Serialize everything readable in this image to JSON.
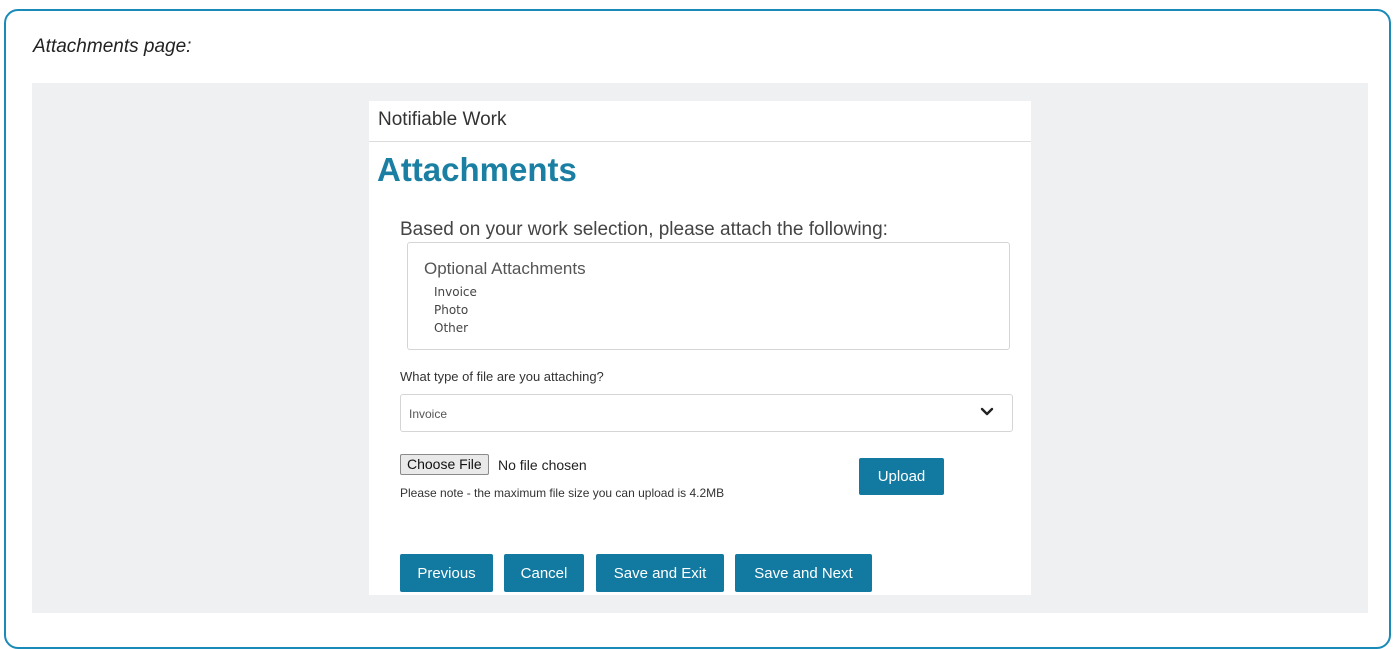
{
  "caption": "Attachments page:",
  "header": {
    "title": "Notifiable Work"
  },
  "page_title": "Attachments",
  "intro_text": "Based on your work selection, please attach the following:",
  "attachments": {
    "title": "Optional Attachments",
    "items": [
      "Invoice",
      "Photo",
      "Other"
    ]
  },
  "file_type": {
    "label": "What type of file are you attaching?",
    "selected": "Invoice"
  },
  "file_input": {
    "button_label": "Choose File",
    "status": "No file chosen"
  },
  "size_note": "Please note - the maximum file size you can upload is 4.2MB",
  "buttons": {
    "upload": "Upload",
    "previous": "Previous",
    "cancel": "Cancel",
    "save_exit": "Save and Exit",
    "save_next": "Save and Next"
  },
  "colors": {
    "accent": "#127aa0",
    "title": "#1a7fa3",
    "frame_border": "#1a8ab8"
  },
  "icons": {
    "select_arrow": "chevron-down-icon"
  }
}
